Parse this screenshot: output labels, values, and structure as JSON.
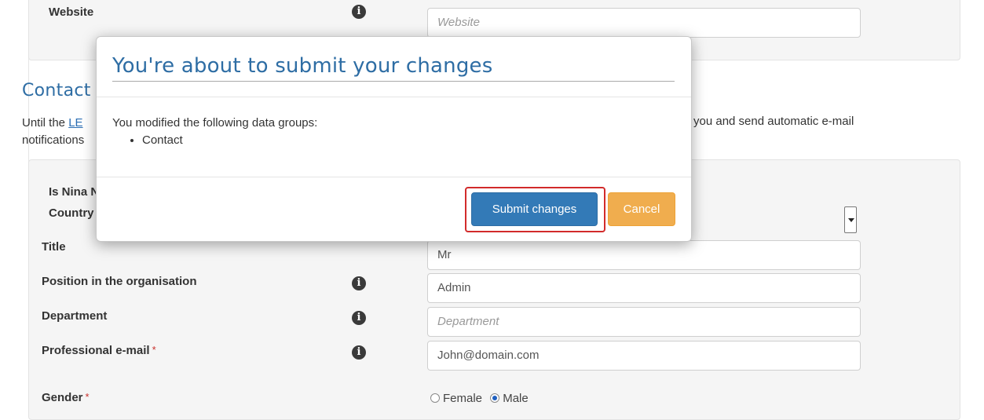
{
  "website_row": {
    "label": "Website",
    "placeholder": "Website"
  },
  "contact_section": {
    "title_visible": "Contact i",
    "intro_left_prefix": "Until the ",
    "intro_link": "LE",
    "intro_right": "you and send automatic e-mail",
    "intro_line2": "notifications"
  },
  "form": {
    "is_label_visible": "Is Nina N",
    "country_label_visible": "Country",
    "title_label": "Title",
    "title_value": "Mr",
    "position_label": "Position in the organisation",
    "position_value": "Admin",
    "department_label": "Department",
    "department_placeholder": "Department",
    "email_label": "Professional e-mail",
    "email_value": "John@domain.com",
    "gender_label": "Gender",
    "required_marker": "*",
    "gender_options": [
      "Female",
      "Male"
    ],
    "gender_selected": "Male"
  },
  "modal": {
    "title": "You're about to submit your changes",
    "body_text": "You modified the following data groups:",
    "groups": [
      "Contact"
    ],
    "submit_label": "Submit changes",
    "cancel_label": "Cancel"
  },
  "colors": {
    "primary": "#337ab7",
    "warning": "#f0ad4e",
    "highlight": "#d22b2b",
    "heading": "#2e6da4"
  }
}
